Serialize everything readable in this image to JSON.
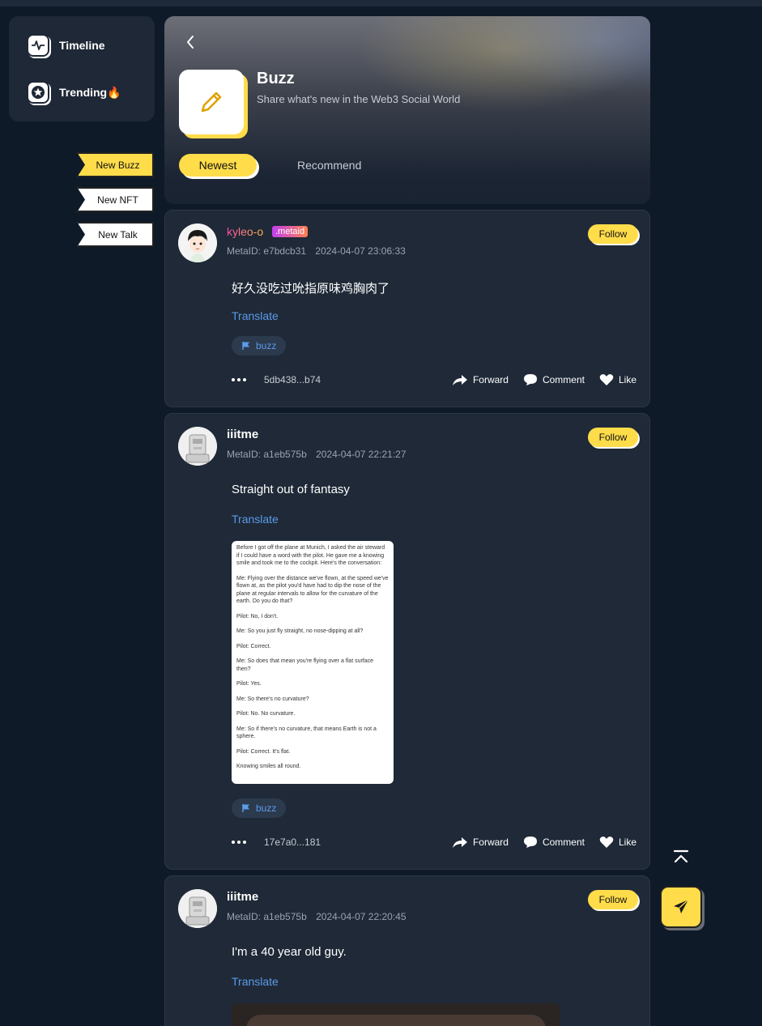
{
  "nav": {
    "items": [
      {
        "label": "Timeline",
        "icon": "activity-icon"
      },
      {
        "label": "Trending🔥",
        "icon": "star-icon"
      }
    ]
  },
  "ribbons": [
    "New Buzz",
    "New NFT",
    "New Talk"
  ],
  "header": {
    "title": "Buzz",
    "subtitle": "Share what's new in the Web3 Social World",
    "tabs": {
      "active": "Newest",
      "other": "Recommend"
    }
  },
  "posts": [
    {
      "username": "kyleo-o",
      "badge": ".metaid",
      "metaid": "MetaID: e7bdcb31",
      "time": "2024-04-07 23:06:33",
      "follow": "Follow",
      "content": "好久没吃过吮指原味鸡胸肉了",
      "translate": "Translate",
      "tag": "buzz",
      "txid": "5db438...b74",
      "actions": {
        "forward": "Forward",
        "comment": "Comment",
        "like": "Like"
      }
    },
    {
      "username": "iiitme",
      "metaid": "MetaID: a1eb575b",
      "time": "2024-04-07 22:21:27",
      "follow": "Follow",
      "content": "Straight out of fantasy",
      "translate": "Translate",
      "image_text": [
        "Before I got off the plane at Munich, I asked the air steward if I could have a word with the pilot. He gave me a knowing smile and took me to the cockpit. Here's the conversation:",
        "Me: Flying over the distance we've flown, at the speed we've flown at, as the pilot you'd have had to dip the nose of the plane at regular intervals to allow for the curvature of the earth. Do you do that?",
        "Pilot: No, I don't.",
        "Me: So you just fly straight, no nose-dipping at all?",
        "Pilot: Correct.",
        "Me: So does that mean you're flying over a flat surface then?",
        "Pilot: Yes.",
        "Me: So there's no curvature?",
        "Pilot: No. No curvature.",
        "Me: So if there's no curvature, that means Earth is not a sphere.",
        "Pilot: Correct. It's flat.",
        "Knowing smiles all round."
      ],
      "tag": "buzz",
      "txid": "17e7a0...181",
      "actions": {
        "forward": "Forward",
        "comment": "Comment",
        "like": "Like"
      }
    },
    {
      "username": "iiitme",
      "metaid": "MetaID: a1eb575b",
      "time": "2024-04-07 22:20:45",
      "follow": "Follow",
      "content": "I'm a 40 year old guy.",
      "translate": "Translate"
    }
  ],
  "colors": {
    "background": "#0f1a29",
    "card": "#1f2937",
    "accent": "#ffdc4a",
    "link": "#5b9be8"
  }
}
